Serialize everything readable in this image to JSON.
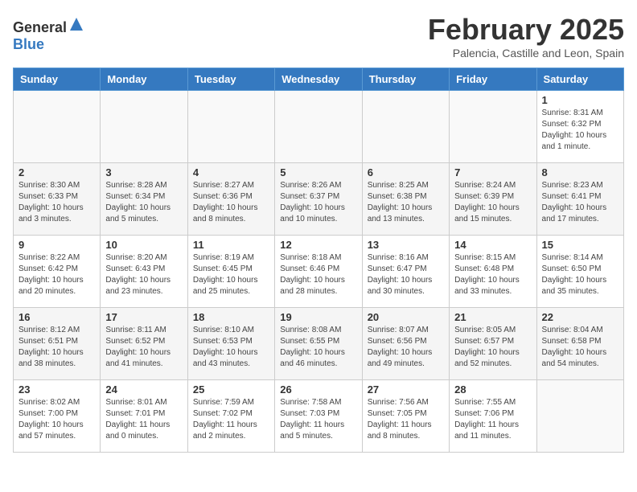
{
  "header": {
    "logo_general": "General",
    "logo_blue": "Blue",
    "month_title": "February 2025",
    "subtitle": "Palencia, Castille and Leon, Spain"
  },
  "weekdays": [
    "Sunday",
    "Monday",
    "Tuesday",
    "Wednesday",
    "Thursday",
    "Friday",
    "Saturday"
  ],
  "weeks": [
    {
      "days": [
        {
          "number": "",
          "info": ""
        },
        {
          "number": "",
          "info": ""
        },
        {
          "number": "",
          "info": ""
        },
        {
          "number": "",
          "info": ""
        },
        {
          "number": "",
          "info": ""
        },
        {
          "number": "",
          "info": ""
        },
        {
          "number": "1",
          "info": "Sunrise: 8:31 AM\nSunset: 6:32 PM\nDaylight: 10 hours and 1 minute."
        }
      ]
    },
    {
      "days": [
        {
          "number": "2",
          "info": "Sunrise: 8:30 AM\nSunset: 6:33 PM\nDaylight: 10 hours and 3 minutes."
        },
        {
          "number": "3",
          "info": "Sunrise: 8:28 AM\nSunset: 6:34 PM\nDaylight: 10 hours and 5 minutes."
        },
        {
          "number": "4",
          "info": "Sunrise: 8:27 AM\nSunset: 6:36 PM\nDaylight: 10 hours and 8 minutes."
        },
        {
          "number": "5",
          "info": "Sunrise: 8:26 AM\nSunset: 6:37 PM\nDaylight: 10 hours and 10 minutes."
        },
        {
          "number": "6",
          "info": "Sunrise: 8:25 AM\nSunset: 6:38 PM\nDaylight: 10 hours and 13 minutes."
        },
        {
          "number": "7",
          "info": "Sunrise: 8:24 AM\nSunset: 6:39 PM\nDaylight: 10 hours and 15 minutes."
        },
        {
          "number": "8",
          "info": "Sunrise: 8:23 AM\nSunset: 6:41 PM\nDaylight: 10 hours and 17 minutes."
        }
      ]
    },
    {
      "days": [
        {
          "number": "9",
          "info": "Sunrise: 8:22 AM\nSunset: 6:42 PM\nDaylight: 10 hours and 20 minutes."
        },
        {
          "number": "10",
          "info": "Sunrise: 8:20 AM\nSunset: 6:43 PM\nDaylight: 10 hours and 23 minutes."
        },
        {
          "number": "11",
          "info": "Sunrise: 8:19 AM\nSunset: 6:45 PM\nDaylight: 10 hours and 25 minutes."
        },
        {
          "number": "12",
          "info": "Sunrise: 8:18 AM\nSunset: 6:46 PM\nDaylight: 10 hours and 28 minutes."
        },
        {
          "number": "13",
          "info": "Sunrise: 8:16 AM\nSunset: 6:47 PM\nDaylight: 10 hours and 30 minutes."
        },
        {
          "number": "14",
          "info": "Sunrise: 8:15 AM\nSunset: 6:48 PM\nDaylight: 10 hours and 33 minutes."
        },
        {
          "number": "15",
          "info": "Sunrise: 8:14 AM\nSunset: 6:50 PM\nDaylight: 10 hours and 35 minutes."
        }
      ]
    },
    {
      "days": [
        {
          "number": "16",
          "info": "Sunrise: 8:12 AM\nSunset: 6:51 PM\nDaylight: 10 hours and 38 minutes."
        },
        {
          "number": "17",
          "info": "Sunrise: 8:11 AM\nSunset: 6:52 PM\nDaylight: 10 hours and 41 minutes."
        },
        {
          "number": "18",
          "info": "Sunrise: 8:10 AM\nSunset: 6:53 PM\nDaylight: 10 hours and 43 minutes."
        },
        {
          "number": "19",
          "info": "Sunrise: 8:08 AM\nSunset: 6:55 PM\nDaylight: 10 hours and 46 minutes."
        },
        {
          "number": "20",
          "info": "Sunrise: 8:07 AM\nSunset: 6:56 PM\nDaylight: 10 hours and 49 minutes."
        },
        {
          "number": "21",
          "info": "Sunrise: 8:05 AM\nSunset: 6:57 PM\nDaylight: 10 hours and 52 minutes."
        },
        {
          "number": "22",
          "info": "Sunrise: 8:04 AM\nSunset: 6:58 PM\nDaylight: 10 hours and 54 minutes."
        }
      ]
    },
    {
      "days": [
        {
          "number": "23",
          "info": "Sunrise: 8:02 AM\nSunset: 7:00 PM\nDaylight: 10 hours and 57 minutes."
        },
        {
          "number": "24",
          "info": "Sunrise: 8:01 AM\nSunset: 7:01 PM\nDaylight: 11 hours and 0 minutes."
        },
        {
          "number": "25",
          "info": "Sunrise: 7:59 AM\nSunset: 7:02 PM\nDaylight: 11 hours and 2 minutes."
        },
        {
          "number": "26",
          "info": "Sunrise: 7:58 AM\nSunset: 7:03 PM\nDaylight: 11 hours and 5 minutes."
        },
        {
          "number": "27",
          "info": "Sunrise: 7:56 AM\nSunset: 7:05 PM\nDaylight: 11 hours and 8 minutes."
        },
        {
          "number": "28",
          "info": "Sunrise: 7:55 AM\nSunset: 7:06 PM\nDaylight: 11 hours and 11 minutes."
        },
        {
          "number": "",
          "info": ""
        }
      ]
    }
  ]
}
